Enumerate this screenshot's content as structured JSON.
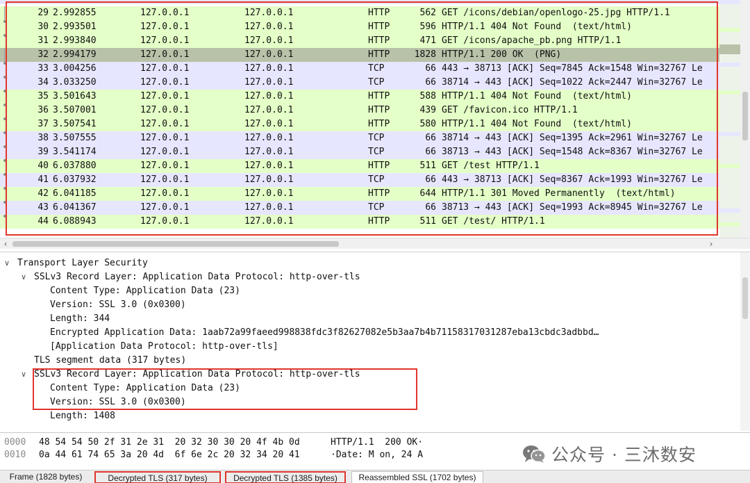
{
  "packets": [
    {
      "no": "29",
      "time": "2.992855",
      "src": "127.0.0.1",
      "dst": "127.0.0.1",
      "proto": "HTTP",
      "len": "562",
      "info": "GET /icons/debian/openlogo-25.jpg HTTP/1.1",
      "kind": "http"
    },
    {
      "no": "30",
      "time": "2.993501",
      "src": "127.0.0.1",
      "dst": "127.0.0.1",
      "proto": "HTTP",
      "len": "596",
      "info": "HTTP/1.1 404 Not Found  (text/html)",
      "kind": "http"
    },
    {
      "no": "31",
      "time": "2.993840",
      "src": "127.0.0.1",
      "dst": "127.0.0.1",
      "proto": "HTTP",
      "len": "471",
      "info": "GET /icons/apache_pb.png HTTP/1.1",
      "kind": "http"
    },
    {
      "no": "32",
      "time": "2.994179",
      "src": "127.0.0.1",
      "dst": "127.0.0.1",
      "proto": "HTTP",
      "len": "1828",
      "info": "HTTP/1.1 200 OK  (PNG)",
      "kind": "selected"
    },
    {
      "no": "33",
      "time": "3.004256",
      "src": "127.0.0.1",
      "dst": "127.0.0.1",
      "proto": "TCP",
      "len": "66",
      "info": "443 → 38713 [ACK] Seq=7845 Ack=1548 Win=32767 Le",
      "kind": "tcp"
    },
    {
      "no": "34",
      "time": "3.033250",
      "src": "127.0.0.1",
      "dst": "127.0.0.1",
      "proto": "TCP",
      "len": "66",
      "info": "38714 → 443 [ACK] Seq=1022 Ack=2447 Win=32767 Le",
      "kind": "tcp"
    },
    {
      "no": "35",
      "time": "3.501643",
      "src": "127.0.0.1",
      "dst": "127.0.0.1",
      "proto": "HTTP",
      "len": "588",
      "info": "HTTP/1.1 404 Not Found  (text/html)",
      "kind": "http"
    },
    {
      "no": "36",
      "time": "3.507001",
      "src": "127.0.0.1",
      "dst": "127.0.0.1",
      "proto": "HTTP",
      "len": "439",
      "info": "GET /favicon.ico HTTP/1.1",
      "kind": "http"
    },
    {
      "no": "37",
      "time": "3.507541",
      "src": "127.0.0.1",
      "dst": "127.0.0.1",
      "proto": "HTTP",
      "len": "580",
      "info": "HTTP/1.1 404 Not Found  (text/html)",
      "kind": "http"
    },
    {
      "no": "38",
      "time": "3.507555",
      "src": "127.0.0.1",
      "dst": "127.0.0.1",
      "proto": "TCP",
      "len": "66",
      "info": "38714 → 443 [ACK] Seq=1395 Ack=2961 Win=32767 Le",
      "kind": "tcp"
    },
    {
      "no": "39",
      "time": "3.541174",
      "src": "127.0.0.1",
      "dst": "127.0.0.1",
      "proto": "TCP",
      "len": "66",
      "info": "38713 → 443 [ACK] Seq=1548 Ack=8367 Win=32767 Le",
      "kind": "tcp"
    },
    {
      "no": "40",
      "time": "6.037880",
      "src": "127.0.0.1",
      "dst": "127.0.0.1",
      "proto": "HTTP",
      "len": "511",
      "info": "GET /test HTTP/1.1",
      "kind": "http"
    },
    {
      "no": "41",
      "time": "6.037932",
      "src": "127.0.0.1",
      "dst": "127.0.0.1",
      "proto": "TCP",
      "len": "66",
      "info": "443 → 38713 [ACK] Seq=8367 Ack=1993 Win=32767 Le",
      "kind": "tcp"
    },
    {
      "no": "42",
      "time": "6.041185",
      "src": "127.0.0.1",
      "dst": "127.0.0.1",
      "proto": "HTTP",
      "len": "644",
      "info": "HTTP/1.1 301 Moved Permanently  (text/html)",
      "kind": "http"
    },
    {
      "no": "43",
      "time": "6.041367",
      "src": "127.0.0.1",
      "dst": "127.0.0.1",
      "proto": "TCP",
      "len": "66",
      "info": "38713 → 443 [ACK] Seq=1993 Ack=8945 Win=32767 Le",
      "kind": "tcp"
    },
    {
      "no": "44",
      "time": "6.088943",
      "src": "127.0.0.1",
      "dst": "127.0.0.1",
      "proto": "HTTP",
      "len": "511",
      "info": "GET /test/ HTTP/1.1",
      "kind": "http"
    }
  ],
  "details": [
    {
      "text": "Transport Layer Security",
      "level": 0,
      "toggle": "open"
    },
    {
      "text": "SSLv3 Record Layer: Application Data Protocol: http-over-tls",
      "level": 1,
      "toggle": "open"
    },
    {
      "text": "Content Type: Application Data (23)",
      "level": 2,
      "toggle": "none"
    },
    {
      "text": "Version: SSL 3.0 (0x0300)",
      "level": 2,
      "toggle": "none"
    },
    {
      "text": "Length: 344",
      "level": 2,
      "toggle": "none"
    },
    {
      "text": "Encrypted Application Data: 1aab72a99faeed998838fdc3f82627082e5b3aa7b4b71158317031287eba13cbdc3adbbd…",
      "level": 2,
      "toggle": "none"
    },
    {
      "text": "[Application Data Protocol: http-over-tls]",
      "level": 2,
      "toggle": "none"
    },
    {
      "text": "TLS segment data (317 bytes)",
      "level": 1,
      "toggle": "none"
    },
    {
      "text": "SSLv3 Record Layer: Application Data Protocol: http-over-tls",
      "level": 1,
      "toggle": "open"
    },
    {
      "text": "Content Type: Application Data (23)",
      "level": 2,
      "toggle": "none"
    },
    {
      "text": "Version: SSL 3.0 (0x0300)",
      "level": 2,
      "toggle": "none"
    },
    {
      "text": "Length: 1408",
      "level": 2,
      "toggle": "none"
    }
  ],
  "bytes": [
    {
      "offset": "0000",
      "hex": "48 54 54 50 2f 31 2e 31  20 32 30 30 20 4f 4b 0d",
      "ascii": "HTTP/1.1  200 OK·"
    },
    {
      "offset": "0010",
      "hex": "0a 44 61 74 65 3a 20 4d  6f 6e 2c 20 32 34 20 41",
      "ascii": "·Date: M on, 24 A"
    }
  ],
  "tabs": [
    {
      "label": "Frame (1828 bytes)",
      "highlighted": false,
      "active": false
    },
    {
      "label": "Decrypted TLS (317 bytes)",
      "highlighted": true,
      "active": false
    },
    {
      "label": "Decrypted TLS (1385 bytes)",
      "highlighted": true,
      "active": false
    },
    {
      "label": "Reassembled SSL (1702 bytes)",
      "highlighted": false,
      "active": true
    }
  ],
  "watermark": {
    "text": "公众号 · 三沐数安",
    "icon": "wechat-icon"
  },
  "colors": {
    "http_row": "#e4ffc7",
    "tcp_row": "#e7e6ff",
    "selected_row": "#b8c2a8",
    "annotation_red": "#e0352b"
  }
}
